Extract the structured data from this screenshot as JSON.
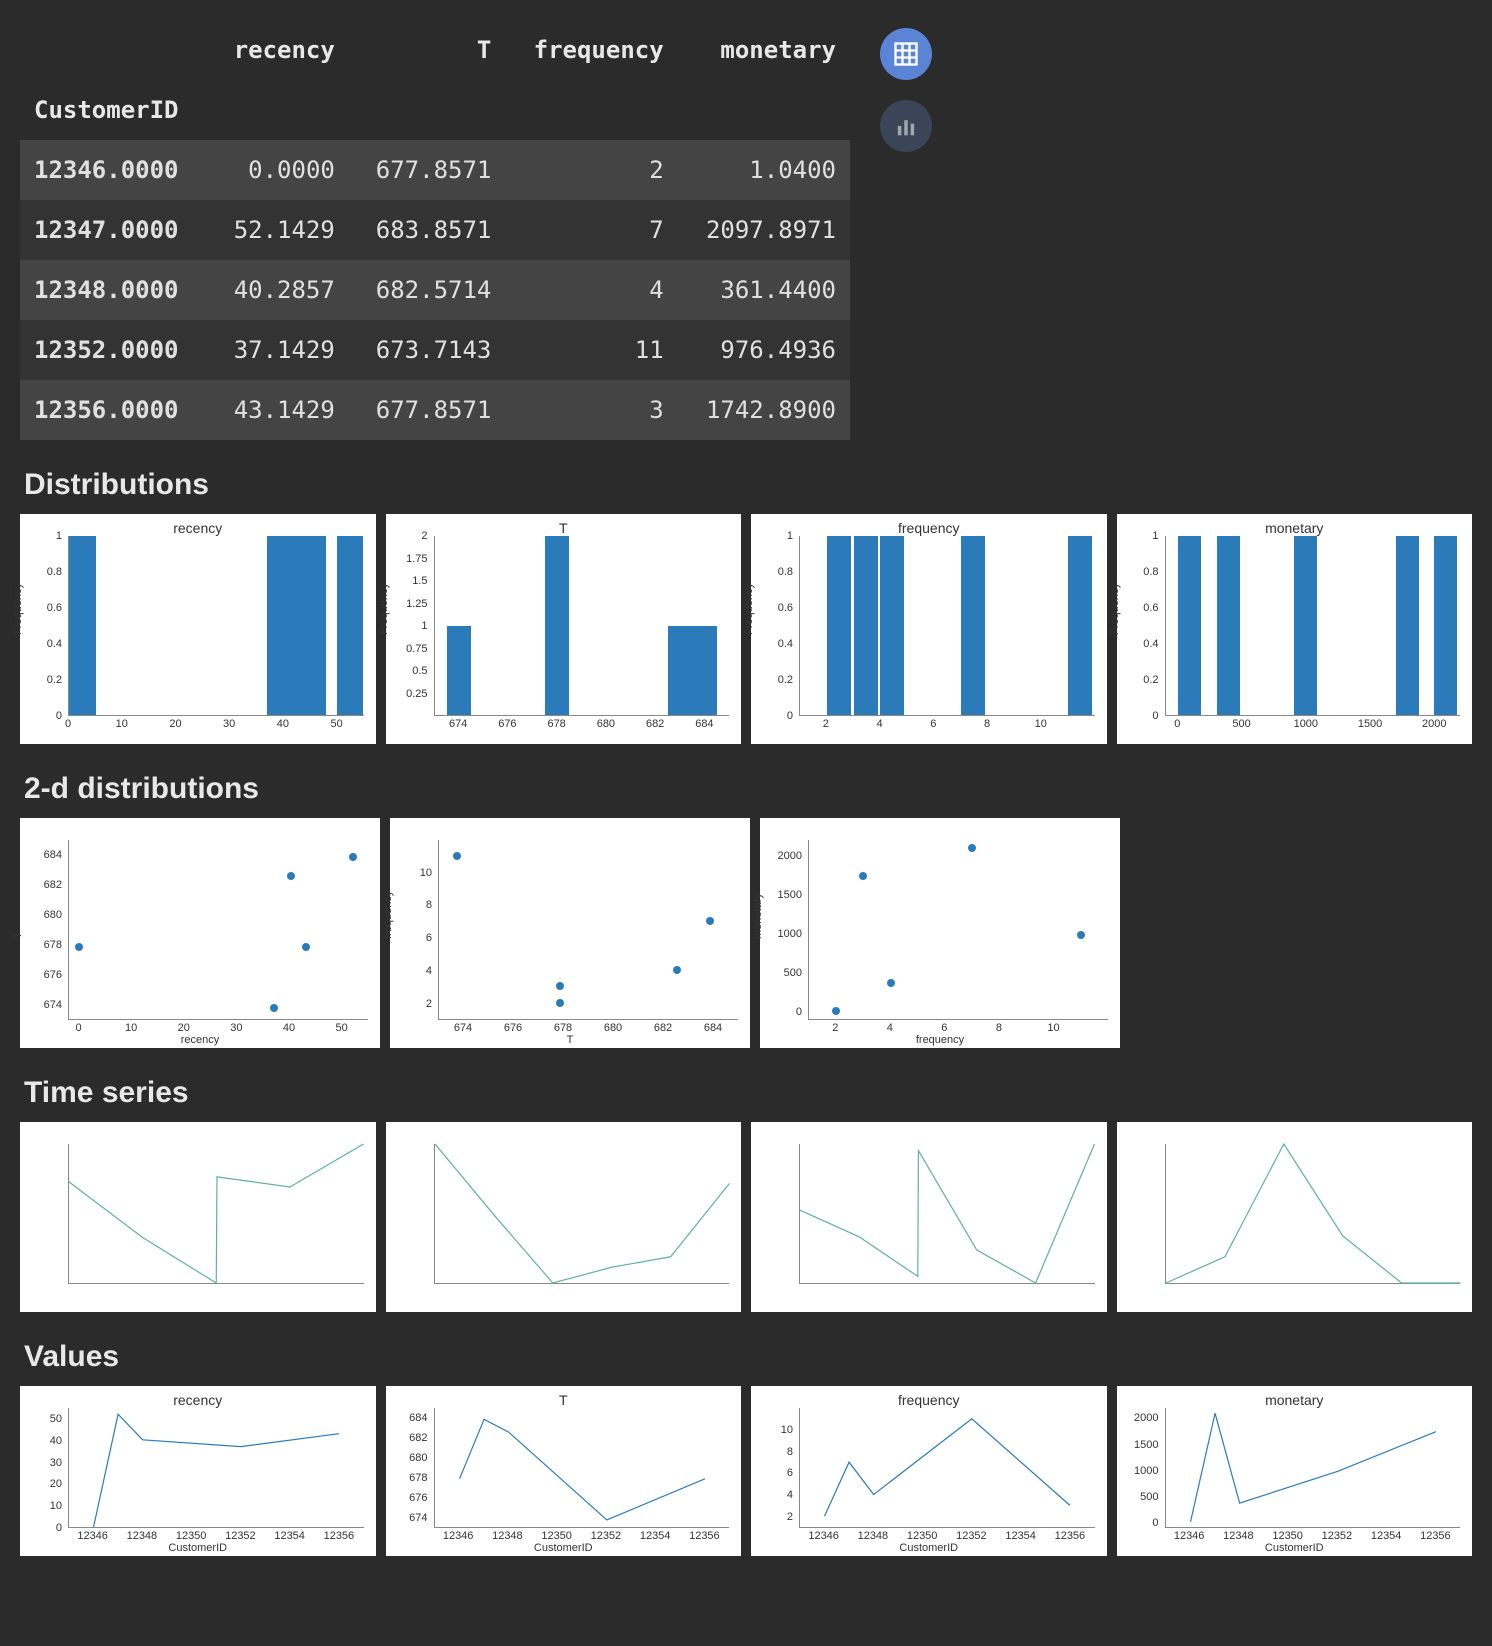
{
  "table": {
    "index_label": "CustomerID",
    "columns": [
      "recency",
      "T",
      "frequency",
      "monetary"
    ],
    "rows": [
      {
        "id": "12346.0000",
        "recency": "0.0000",
        "T": "677.8571",
        "frequency": "2",
        "monetary": "1.0400"
      },
      {
        "id": "12347.0000",
        "recency": "52.1429",
        "T": "683.8571",
        "frequency": "7",
        "monetary": "2097.8971"
      },
      {
        "id": "12348.0000",
        "recency": "40.2857",
        "T": "682.5714",
        "frequency": "4",
        "monetary": "361.4400"
      },
      {
        "id": "12352.0000",
        "recency": "37.1429",
        "T": "673.7143",
        "frequency": "11",
        "monetary": "976.4936"
      },
      {
        "id": "12356.0000",
        "recency": "43.1429",
        "T": "677.8571",
        "frequency": "3",
        "monetary": "1742.8900"
      }
    ]
  },
  "buttons": {
    "table": "Table view",
    "chart": "Chart view"
  },
  "sections": {
    "dist": "Distributions",
    "dist2d": "2-d distributions",
    "ts": "Time series",
    "vals": "Values"
  },
  "chart_data": {
    "distributions": [
      {
        "type": "bar",
        "title": "recency",
        "xlabel": "",
        "ylabel": "Frequency",
        "xlim": [
          0,
          55
        ],
        "ylim": [
          0,
          1
        ],
        "yticks": [
          0,
          0.2,
          0.4,
          0.6,
          0.8,
          1.0
        ],
        "xticks": [
          0,
          10,
          20,
          30,
          40,
          50
        ],
        "bars": [
          {
            "x": 0,
            "w": 5,
            "h": 1
          },
          {
            "x": 37,
            "w": 5,
            "h": 1
          },
          {
            "x": 40,
            "w": 5,
            "h": 1
          },
          {
            "x": 43,
            "w": 5,
            "h": 1
          },
          {
            "x": 50,
            "w": 5,
            "h": 1
          }
        ]
      },
      {
        "type": "bar",
        "title": "T",
        "xlabel": "",
        "ylabel": "Frequency",
        "xlim": [
          673,
          685
        ],
        "ylim": [
          0,
          2
        ],
        "yticks": [
          0.25,
          0.5,
          0.75,
          1.0,
          1.25,
          1.5,
          1.75,
          2.0
        ],
        "xticks": [
          674,
          676,
          678,
          680,
          682,
          684
        ],
        "bars": [
          {
            "x": 673.5,
            "w": 1,
            "h": 1
          },
          {
            "x": 677.5,
            "w": 1,
            "h": 2
          },
          {
            "x": 682.5,
            "w": 1,
            "h": 1
          },
          {
            "x": 683.5,
            "w": 1,
            "h": 1
          }
        ]
      },
      {
        "type": "bar",
        "title": "frequency",
        "xlabel": "",
        "ylabel": "Frequency",
        "xlim": [
          1,
          12
        ],
        "ylim": [
          0,
          1
        ],
        "yticks": [
          0,
          0.2,
          0.4,
          0.6,
          0.8,
          1.0
        ],
        "xticks": [
          2,
          4,
          6,
          8,
          10
        ],
        "bars": [
          {
            "x": 2,
            "w": 0.9,
            "h": 1
          },
          {
            "x": 3,
            "w": 0.9,
            "h": 1
          },
          {
            "x": 4,
            "w": 0.9,
            "h": 1
          },
          {
            "x": 7,
            "w": 0.9,
            "h": 1
          },
          {
            "x": 11,
            "w": 0.9,
            "h": 1
          }
        ]
      },
      {
        "type": "bar",
        "title": "monetary",
        "xlabel": "",
        "ylabel": "Frequency",
        "xlim": [
          -100,
          2200
        ],
        "ylim": [
          0,
          1
        ],
        "yticks": [
          0,
          0.2,
          0.4,
          0.6,
          0.8,
          1.0
        ],
        "xticks": [
          0,
          500,
          1000,
          1500,
          2000
        ],
        "bars": [
          {
            "x": 0,
            "w": 180,
            "h": 1
          },
          {
            "x": 300,
            "w": 180,
            "h": 1
          },
          {
            "x": 900,
            "w": 180,
            "h": 1
          },
          {
            "x": 1700,
            "w": 180,
            "h": 1
          },
          {
            "x": 2000,
            "w": 180,
            "h": 1
          }
        ]
      }
    ],
    "dist2d": [
      {
        "type": "scatter",
        "title": "",
        "xlabel": "recency",
        "ylabel": "T",
        "xlim": [
          -2,
          55
        ],
        "ylim": [
          673,
          685
        ],
        "xticks": [
          0,
          10,
          20,
          30,
          40,
          50
        ],
        "yticks": [
          674,
          676,
          678,
          680,
          682,
          684
        ],
        "points": [
          {
            "x": 0,
            "y": 677.86
          },
          {
            "x": 52.14,
            "y": 683.86
          },
          {
            "x": 40.29,
            "y": 682.57
          },
          {
            "x": 37.14,
            "y": 673.71
          },
          {
            "x": 43.14,
            "y": 677.86
          }
        ]
      },
      {
        "type": "scatter",
        "title": "",
        "xlabel": "T",
        "ylabel": "frequency",
        "xlim": [
          673,
          685
        ],
        "ylim": [
          1,
          12
        ],
        "xticks": [
          674,
          676,
          678,
          680,
          682,
          684
        ],
        "yticks": [
          2,
          4,
          6,
          8,
          10
        ],
        "points": [
          {
            "x": 677.86,
            "y": 2
          },
          {
            "x": 683.86,
            "y": 7
          },
          {
            "x": 682.57,
            "y": 4
          },
          {
            "x": 673.71,
            "y": 11
          },
          {
            "x": 677.86,
            "y": 3
          }
        ]
      },
      {
        "type": "scatter",
        "title": "",
        "xlabel": "frequency",
        "ylabel": "monetary",
        "xlim": [
          1,
          12
        ],
        "ylim": [
          -100,
          2200
        ],
        "xticks": [
          2,
          4,
          6,
          8,
          10
        ],
        "yticks": [
          0,
          500,
          1000,
          1500,
          2000
        ],
        "points": [
          {
            "x": 2,
            "y": 1.04
          },
          {
            "x": 7,
            "y": 2097.9
          },
          {
            "x": 4,
            "y": 361.44
          },
          {
            "x": 11,
            "y": 976.49
          },
          {
            "x": 3,
            "y": 1742.89
          }
        ]
      }
    ],
    "timeseries": [
      {
        "type": "line",
        "title": "",
        "xlabel": "",
        "ylabel": "",
        "color": "#5fb0a0",
        "points": [
          {
            "x": 0,
            "y": 40
          },
          {
            "x": 1,
            "y": 18
          },
          {
            "x": 2,
            "y": 0
          },
          {
            "x": 2.01,
            "y": 42
          },
          {
            "x": 3,
            "y": 38
          },
          {
            "x": 4,
            "y": 55
          }
        ]
      },
      {
        "type": "line",
        "title": "",
        "xlabel": "",
        "ylabel": "",
        "color": "#5fb0a0",
        "points": [
          {
            "x": 0,
            "y": 55
          },
          {
            "x": 1,
            "y": 28
          },
          {
            "x": 2,
            "y": 2
          },
          {
            "x": 3,
            "y": 8
          },
          {
            "x": 4,
            "y": 12
          },
          {
            "x": 5,
            "y": 40
          }
        ]
      },
      {
        "type": "line",
        "title": "",
        "xlabel": "",
        "ylabel": "",
        "color": "#5fb0a0",
        "points": [
          {
            "x": 0,
            "y": 30
          },
          {
            "x": 1,
            "y": 22
          },
          {
            "x": 2,
            "y": 10
          },
          {
            "x": 2.01,
            "y": 48
          },
          {
            "x": 3,
            "y": 18
          },
          {
            "x": 4,
            "y": 8
          },
          {
            "x": 5,
            "y": 50
          }
        ]
      },
      {
        "type": "line",
        "title": "",
        "xlabel": "",
        "ylabel": "",
        "color": "#5fb0a0",
        "points": [
          {
            "x": 0,
            "y": 2
          },
          {
            "x": 1,
            "y": 12
          },
          {
            "x": 2,
            "y": 55
          },
          {
            "x": 3,
            "y": 20
          },
          {
            "x": 4,
            "y": 2
          },
          {
            "x": 5,
            "y": 2
          }
        ]
      }
    ],
    "values": [
      {
        "type": "line",
        "title": "recency",
        "xlabel": "CustomerID",
        "ylabel": "",
        "xlim": [
          12345,
          12357
        ],
        "ylim": [
          0,
          55
        ],
        "xticks": [
          12346,
          12348,
          12350,
          12352,
          12354,
          12356
        ],
        "yticks": [
          0,
          10,
          20,
          30,
          40,
          50
        ],
        "points": [
          {
            "x": 12346,
            "y": 0
          },
          {
            "x": 12347,
            "y": 52.14
          },
          {
            "x": 12348,
            "y": 40.29
          },
          {
            "x": 12352,
            "y": 37.14
          },
          {
            "x": 12356,
            "y": 43.14
          }
        ]
      },
      {
        "type": "line",
        "title": "T",
        "xlabel": "CustomerID",
        "ylabel": "",
        "xlim": [
          12345,
          12357
        ],
        "ylim": [
          673,
          685
        ],
        "xticks": [
          12346,
          12348,
          12350,
          12352,
          12354,
          12356
        ],
        "yticks": [
          674,
          676,
          678,
          680,
          682,
          684
        ],
        "points": [
          {
            "x": 12346,
            "y": 677.86
          },
          {
            "x": 12347,
            "y": 683.86
          },
          {
            "x": 12348,
            "y": 682.57
          },
          {
            "x": 12352,
            "y": 673.71
          },
          {
            "x": 12356,
            "y": 677.86
          }
        ]
      },
      {
        "type": "line",
        "title": "frequency",
        "xlabel": "CustomerID",
        "ylabel": "",
        "xlim": [
          12345,
          12357
        ],
        "ylim": [
          1,
          12
        ],
        "xticks": [
          12346,
          12348,
          12350,
          12352,
          12354,
          12356
        ],
        "yticks": [
          2,
          4,
          6,
          8,
          10
        ],
        "points": [
          {
            "x": 12346,
            "y": 2
          },
          {
            "x": 12347,
            "y": 7
          },
          {
            "x": 12348,
            "y": 4
          },
          {
            "x": 12352,
            "y": 11
          },
          {
            "x": 12356,
            "y": 3
          }
        ]
      },
      {
        "type": "line",
        "title": "monetary",
        "xlabel": "CustomerID",
        "ylabel": "",
        "xlim": [
          12345,
          12357
        ],
        "ylim": [
          -100,
          2200
        ],
        "xticks": [
          12346,
          12348,
          12350,
          12352,
          12354,
          12356
        ],
        "yticks": [
          0,
          500,
          1000,
          1500,
          2000
        ],
        "points": [
          {
            "x": 12346,
            "y": 1.04
          },
          {
            "x": 12347,
            "y": 2097.9
          },
          {
            "x": 12348,
            "y": 361.44
          },
          {
            "x": 12352,
            "y": 976.49
          },
          {
            "x": 12356,
            "y": 1742.89
          }
        ]
      }
    ]
  }
}
